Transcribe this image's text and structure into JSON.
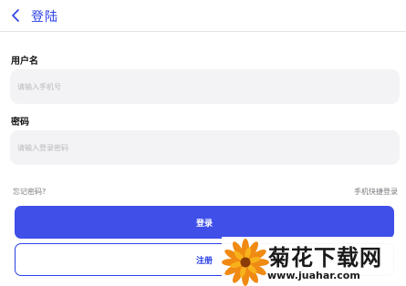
{
  "header": {
    "back_icon": "chevron-left-icon",
    "title": "登陆"
  },
  "form": {
    "username_label": "用户名",
    "username_placeholder": "请输入手机号",
    "username_value": "",
    "password_label": "密码",
    "password_placeholder": "请输入登录密码",
    "password_value": ""
  },
  "links": {
    "forgot_password": "忘记密码?",
    "quick_login": "手机快捷登录"
  },
  "buttons": {
    "login": "登录",
    "register": "注册"
  },
  "watermark": {
    "title": "菊花下载网",
    "url": "www.juahar.com"
  },
  "colors": {
    "accent": "#2b40e6",
    "primary_button": "#3f4fe8",
    "input_bg": "#f3f3f5"
  }
}
